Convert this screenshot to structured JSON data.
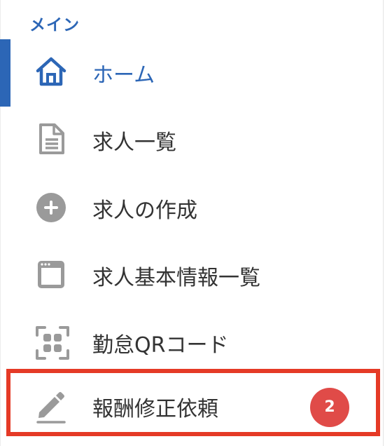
{
  "sidebar": {
    "section_label": "メイン",
    "accent_color": "#2c66b6",
    "highlight_color": "#e53a26",
    "items": [
      {
        "label": "ホーム",
        "icon": "home-icon",
        "active": true
      },
      {
        "label": "求人一覧",
        "icon": "document-icon",
        "active": false
      },
      {
        "label": "求人の作成",
        "icon": "plus-circle-icon",
        "active": false
      },
      {
        "label": "求人基本情報一覧",
        "icon": "window-icon",
        "active": false
      },
      {
        "label": "勤怠QRコード",
        "icon": "qr-scan-icon",
        "active": false
      },
      {
        "label": "報酬修正依頼",
        "icon": "pencil-icon",
        "active": false,
        "badge": "2"
      }
    ]
  }
}
